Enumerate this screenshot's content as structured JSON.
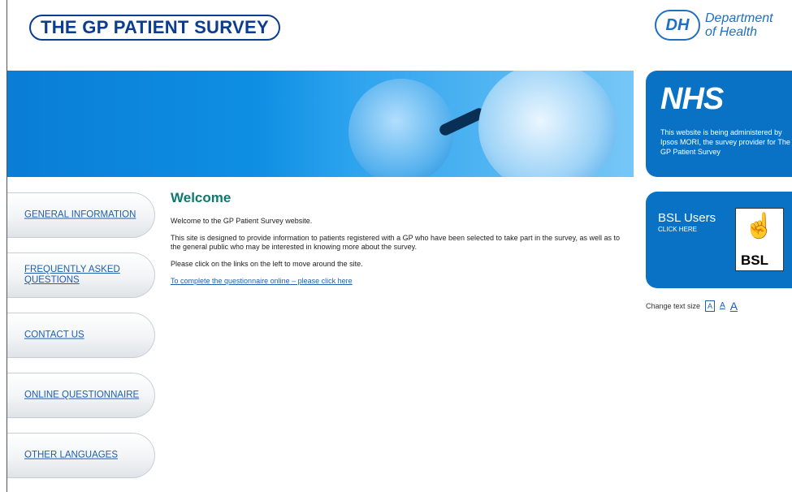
{
  "header": {
    "logo": "THE GP PATIENT SURVEY",
    "dh_badge": "DH",
    "dh_line1": "Department",
    "dh_line2": "of Health"
  },
  "nhs_panel": {
    "logo": "NHS",
    "text": "This website is being administered by Ipsos MORI, the survey provider for The GP Patient Survey"
  },
  "nav": {
    "items": [
      {
        "label": "GENERAL INFORMATION"
      },
      {
        "label": "FREQUENTLY ASKED QUESTIONS"
      },
      {
        "label": "CONTACT US"
      },
      {
        "label": "ONLINE QUESTIONNAIRE"
      },
      {
        "label": "OTHER LANGUAGES"
      }
    ]
  },
  "main": {
    "title": "Welcome",
    "p1": "Welcome to the GP Patient Survey website.",
    "p2": "This site is designed to provide information to patients registered with a GP who have been selected to take part in the survey, as well as to the general public who may be interested in knowing more about the survey.",
    "p3": "Please click on the links on the left to move around the site.",
    "link": "To complete the questionnaire online – please click here"
  },
  "bsl": {
    "title": "BSL Users",
    "subtitle": "CLICK HERE",
    "card_text": "BSL"
  },
  "text_size": {
    "label": "Change text size",
    "small": "A",
    "medium": "A",
    "large": "A"
  },
  "icons": {
    "hand": "sign-language-hand-icon"
  }
}
